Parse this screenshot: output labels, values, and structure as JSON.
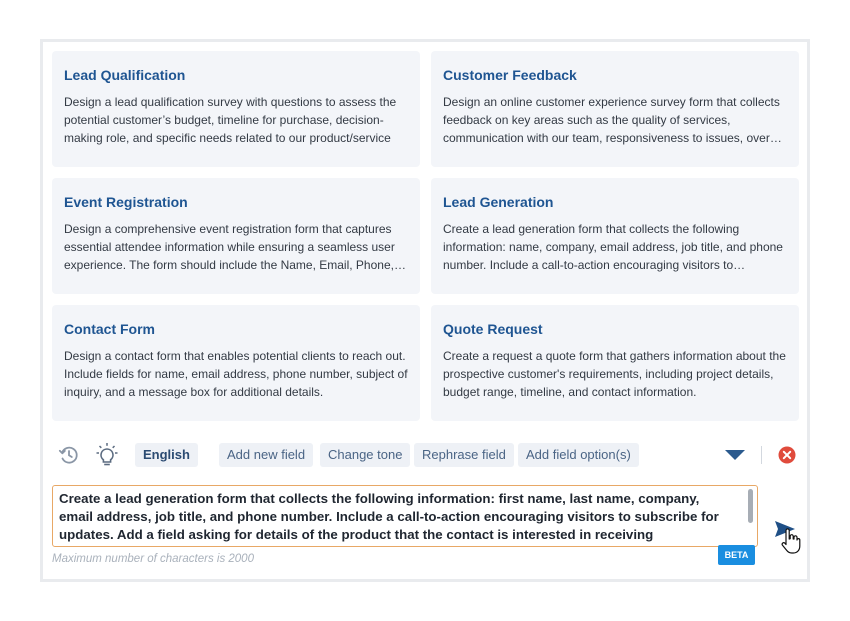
{
  "templates": [
    {
      "title": "Lead Qualification",
      "description": "Design a lead qualification survey with questions to assess the potential customer’s budget, timeline for purchase, decision-making role, and specific needs related to our product/service"
    },
    {
      "title": "Customer Feedback",
      "description": "Design an online customer experience survey form that collects feedback on key areas such as the quality of services, communication with our team, responsiveness to issues, overall satisfaction, and areas for improvement."
    },
    {
      "title": "Event Registration",
      "description": "Design a comprehensive event registration form that captures essential attendee information while ensuring a seamless user experience. The form should include the Name, Email, Phone, Company, and Dietary Requirements fields."
    },
    {
      "title": "Lead Generation",
      "description": "Create a lead generation form that collects the following information: name, company, email address, job title, and phone number. Include a call-to-action encouraging visitors to subscribe for updates."
    },
    {
      "title": "Contact Form",
      "description": "Design a contact form that enables potential clients to reach out. Include fields for name, email address, phone number, subject of inquiry, and a message box for additional details."
    },
    {
      "title": "Quote Request",
      "description": "Create a request a quote form that gathers information about the prospective customer's requirements, including project details, budget range, timeline, and contact information."
    }
  ],
  "toolbar": {
    "history_icon": "history-icon",
    "ideas_icon": "lightbulb-icon",
    "language": "English",
    "actions": [
      "Add new field",
      "Change tone",
      "Rephrase field",
      "Add field option(s)"
    ],
    "expand_icon": "caret-down-icon",
    "close_icon": "close-circle-icon"
  },
  "prompt": {
    "value": "Create a lead generation form that collects the following information: first name, last name, company, email address, job title, and phone number. Include a call-to-action encouraging visitors to subscribe for updates.  Add a field asking for details of the product that the contact is interested in receiving"
  },
  "hint": "Maximum number of characters is 2000",
  "badge": "BETA",
  "send_icon": "send-icon",
  "colors": {
    "title": "#1f5592",
    "card_bg": "#f3f5f9",
    "accent": "#1a8ee0",
    "close": "#e04b3c",
    "textarea_border": "#e8a866"
  }
}
